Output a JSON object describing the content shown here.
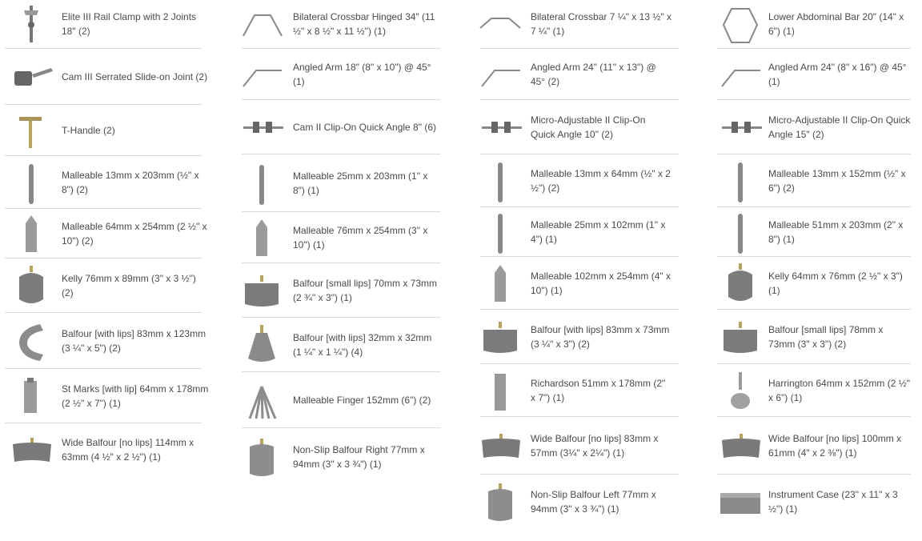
{
  "catalog": {
    "column_1": {
      "items": [
        {
          "icon": "rail-clamp-icon",
          "label": "Elite III Rail Clamp with 2 Joints 18\" (2)"
        },
        {
          "icon": "serrated-joint-icon",
          "label": "Cam III Serrated Slide-on Joint (2)"
        },
        {
          "icon": "t-handle-icon",
          "label": "T-Handle  (2)"
        },
        {
          "icon": "malleable-rod-icon",
          "label": "Malleable 13mm x 203mm (½\" x 8\")  (2)"
        },
        {
          "icon": "malleable-blade-icon",
          "label": "Malleable 64mm x 254mm (2 ½\" x 10\")   (2)"
        },
        {
          "icon": "kelly-blade-icon",
          "label": "Kelly 76mm x 89mm (3\" x 3 ½\") (2)"
        },
        {
          "icon": "curved-blade-icon",
          "label": "Balfour [with lips] 83mm x 123mm (3 ¼\" x 5\")  (2)"
        },
        {
          "icon": "st-marks-blade-icon",
          "label": "St Marks [with lip] 64mm x 178mm (2 ½\" x 7\")   (1)"
        },
        {
          "icon": "wide-balfour-icon",
          "label": "Wide Balfour [no lips] 114mm x 63mm (4 ½\" x 2 ½\")   (1)"
        }
      ]
    },
    "column_2": {
      "items": [
        {
          "icon": "hinged-crossbar-icon",
          "label": "Bilateral Crossbar Hinged 34\" (11 ½\" x 8 ½\" x 11 ½\") (1)"
        },
        {
          "icon": "angled-arm-icon",
          "label": "Angled Arm 18\" (8\" x 10\") @ 45°  (1)"
        },
        {
          "icon": "clip-on-icon",
          "label": "Cam II Clip-On Quick Angle 8\"  (6)"
        },
        {
          "icon": "malleable-rod-icon",
          "label": "Malleable 25mm x 203mm (1\" x 8\") (1)"
        },
        {
          "icon": "malleable-blade-icon",
          "label": "Malleable 76mm x 254mm (3\" x 10\") (1)"
        },
        {
          "icon": "balfour-blade-icon",
          "label": "Balfour [small lips] 70mm x 73mm (2 ¾\" x 3\")   (1)"
        },
        {
          "icon": "balfour-lips-icon",
          "label": "Balfour [with lips] 32mm x 32mm (1 ¼\" x 1 ¼\")  (4)"
        },
        {
          "icon": "malleable-finger-icon",
          "label": "Malleable Finger 152mm (6\")  (2)"
        },
        {
          "icon": "non-slip-balfour-icon",
          "label": "Non-Slip Balfour Right 77mm x 94mm (3\" x 3 ¾\")  (1)"
        }
      ]
    },
    "column_3": {
      "items": [
        {
          "icon": "crossbar-icon",
          "label": "Bilateral Crossbar 7 ¼\" x 13 ½\" x 7 ¼\"  (1)"
        },
        {
          "icon": "angled-arm-icon",
          "label": "Angled Arm 24\" (11\" x 13\") @ 45°  (2)"
        },
        {
          "icon": "clip-on-icon",
          "label": "Micro-Adjustable II Clip-On Quick Angle 10\"  (2)"
        },
        {
          "icon": "malleable-rod-icon",
          "label": "Malleable 13mm x 64mm (½\" x 2 ½\")  (2)"
        },
        {
          "icon": "malleable-rod-icon",
          "label": "Malleable 25mm x 102mm (1\" x 4\")  (1)"
        },
        {
          "icon": "malleable-blade-icon",
          "label": "Malleable 102mm x 254mm (4\" x 10\")   (1)"
        },
        {
          "icon": "balfour-blade-icon",
          "label": "Balfour [with lips] 83mm x 73mm (3 ¼\" x 3\")  (2)"
        },
        {
          "icon": "richardson-blade-icon",
          "label": "Richardson 51mm x 178mm (2\" x 7\") (1)"
        },
        {
          "icon": "wide-balfour-icon",
          "label": "Wide Balfour [no lips] 83mm x 57mm (3¼\" x 2¼\") (1)"
        },
        {
          "icon": "non-slip-balfour-icon",
          "label": "Non-Slip Balfour Left 77mm x 94mm (3\" x 3 ¾\") (1)"
        }
      ]
    },
    "column_4": {
      "items": [
        {
          "icon": "abdominal-bar-icon",
          "label": "Lower Abdominal Bar 20\" (14\" x 6\") (1)"
        },
        {
          "icon": "angled-arm-icon",
          "label": "Angled Arm 24\" (8\" x 16\") @ 45°  (1)"
        },
        {
          "icon": "clip-on-icon",
          "label": "Micro-Adjustable II Clip-On Quick Angle 15\"  (2)"
        },
        {
          "icon": "malleable-rod-icon",
          "label": "Malleable 13mm x 152mm (½\" x 6\")   (2)"
        },
        {
          "icon": "malleable-rod-icon",
          "label": "Malleable 51mm x 203mm (2\" x 8\") (1)"
        },
        {
          "icon": "kelly-blade-icon",
          "label": "Kelly 64mm x 76mm (2 ½\" x 3\") (1)"
        },
        {
          "icon": "balfour-blade-icon",
          "label": "Balfour [small lips] 78mm x 73mm (3\" x 3\")  (2)"
        },
        {
          "icon": "harrington-blade-icon",
          "label": "Harrington 64mm x 152mm (2 ½\" x 6\")  (1)"
        },
        {
          "icon": "wide-balfour-icon",
          "label": "Wide Balfour [no lips] 100mm x 61mm (4\" x 2 ⅜\")  (1)"
        },
        {
          "icon": "instrument-case-icon",
          "label": "Instrument Case (23\" x 11\" x 3 ½\")  (1)"
        }
      ]
    }
  },
  "colors": {
    "text": "#4a4a4a",
    "separator": "#d9d9d9",
    "metal": "#8f8f8f",
    "brass": "#b8a15a"
  }
}
